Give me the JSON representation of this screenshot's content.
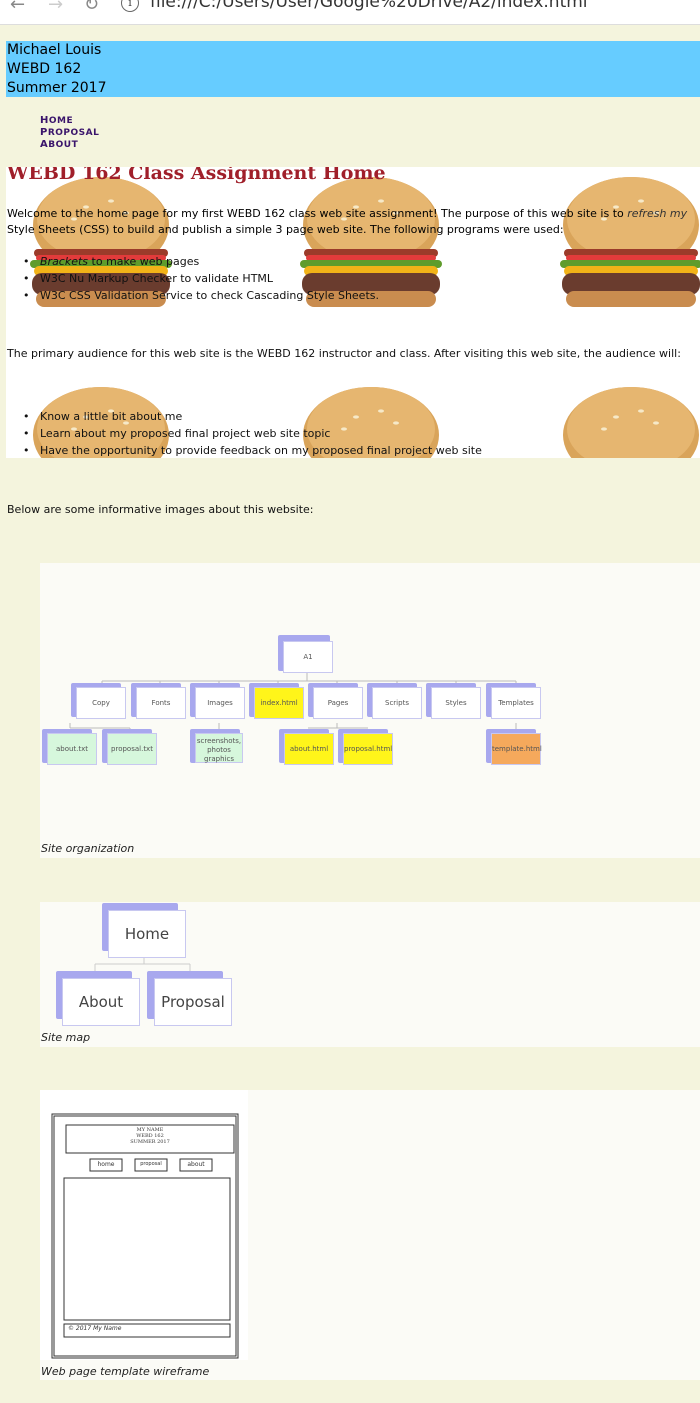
{
  "browser": {
    "url": "file:///C:/Users/User/Google%20Drive/A2/index.html",
    "back_icon": "←",
    "forward_icon": "→",
    "reload_icon": "↻",
    "info_icon": "i"
  },
  "header": {
    "name": "Michael Louis",
    "course": "WEBD 162",
    "term": "Summer 2017",
    "color": "#66ccff"
  },
  "nav": [
    {
      "cap": "H",
      "rest": "OME"
    },
    {
      "cap": "P",
      "rest": "ROPOSAL"
    },
    {
      "cap": "A",
      "rest": "BOUT"
    }
  ],
  "page_title": "WEBD 162 Class Assignment Home",
  "welcome": {
    "before": "Welcome to the home page for my first WEBD 162 class web site assignment! The purpose of this web site is to ",
    "emph": "refresh my",
    "line2": "Style Sheets (CSS) to build and publish a simple 3 page web site. The following programs were used:"
  },
  "programs": [
    {
      "emph": "Brackets",
      "text": " to make web pages"
    },
    {
      "emph": "",
      "text": "W3C Nu Markup Checker to validate HTML"
    },
    {
      "emph": "",
      "text": "W3C CSS Validation Service to check Cascading Style Sheets."
    }
  ],
  "audience_intro": "The primary audience for this web site is the WEBD 162 instructor and class. After visiting this web site, the audience will:",
  "outcomes": [
    "Know a little bit about me",
    "Learn about my proposed final project web site topic",
    "Have the opportunity to provide feedback on my proposed final project web site"
  ],
  "images_intro": "Below are some informative images about this website:",
  "figures": {
    "site_org": {
      "caption": "Site organization",
      "root": "A1",
      "folders": [
        "Copy",
        "Fonts",
        "Images",
        "index.html",
        "Pages",
        "Scripts",
        "Styles",
        "Templates"
      ],
      "files": [
        "about.txt",
        "proposal.txt",
        "screenshots, photos graphics",
        "about.html",
        "proposal.html",
        "template.html"
      ]
    },
    "site_map": {
      "caption": "Site map",
      "home": "Home",
      "about": "About",
      "proposal": "Proposal"
    },
    "wireframe": {
      "caption": "Web page template wireframe",
      "hw_name": "MY NAME",
      "hw_course": "WEBD 162",
      "hw_term": "SUMMER 2017",
      "hw_links": [
        "home",
        "proposal",
        "about"
      ],
      "hw_footer": "© 2017 My Name"
    }
  }
}
